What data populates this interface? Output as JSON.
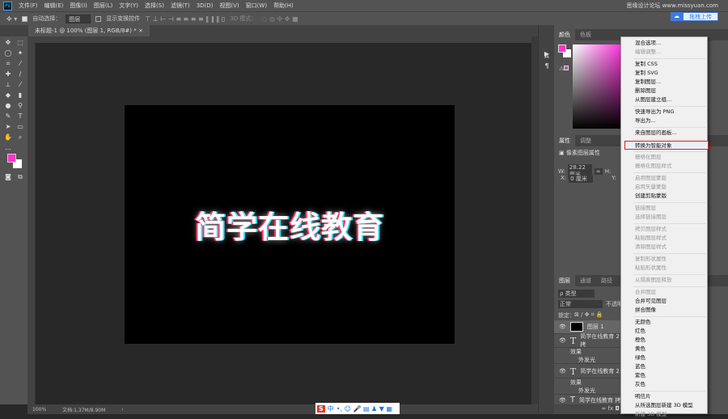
{
  "app": {
    "logo": "Ps",
    "watermark": "思缘设计论坛 www.missyuan.com"
  },
  "menubar": [
    "文件(F)",
    "编辑(E)",
    "图像(I)",
    "图层(L)",
    "文字(Y)",
    "选择(S)",
    "滤镜(T)",
    "3D(D)",
    "视图(V)",
    "窗口(W)",
    "帮助(H)"
  ],
  "options": {
    "auto_select_label": "自动选择：",
    "auto_select_value": "图层",
    "show_transform": "显示变换控件",
    "mode_3d": "3D 模式：",
    "upload": "拖拽上传"
  },
  "doc_tab": {
    "title": "未标题-1 @ 100% (图层 1, RGB/8#) *",
    "close": "×"
  },
  "canvas": {
    "text": "简学在线教育"
  },
  "status": {
    "zoom": "100%",
    "doc": "文档:1.37M/8.90M",
    "arrow": "›"
  },
  "ime": {
    "logo": "S",
    "lang": "中"
  },
  "panels": {
    "color_tabs": [
      "颜色",
      "色板"
    ],
    "props_tabs": [
      "属性",
      "调整"
    ],
    "props_title": "像素图层属性",
    "w_label": "W:",
    "w_value": "28.22 厘米",
    "h_label": "H:",
    "x_label": "X:",
    "x_value": "0 厘米",
    "y_label": "Y:",
    "layer_tabs": [
      "图层",
      "通道",
      "路径"
    ],
    "filter": "ρ 类型",
    "blend": "正常",
    "opacity": "不透明",
    "lock": "锁定：",
    "layers": [
      "图层 1",
      "简学在线教育 2拷",
      "效果",
      "外发光",
      "简学在线教育 2",
      "效果",
      "外发光",
      "简学在线教育 拷"
    ],
    "colors": {
      "foreground": "#ff33cc",
      "background": "#ffffff"
    }
  },
  "context_menu": [
    {
      "label": "混合选项...",
      "d": false
    },
    {
      "label": "编辑调整...",
      "d": true
    },
    {
      "sep": true
    },
    {
      "label": "复制 CSS",
      "d": false
    },
    {
      "label": "复制 SVG",
      "d": false
    },
    {
      "label": "复制图层...",
      "d": false
    },
    {
      "label": "删除图层",
      "d": false
    },
    {
      "label": "从图层建立组...",
      "d": false
    },
    {
      "sep": true
    },
    {
      "label": "快速导出为 PNG",
      "d": false
    },
    {
      "label": "导出为...",
      "d": false
    },
    {
      "sep": true
    },
    {
      "label": "来自图层的画板...",
      "d": false
    },
    {
      "sep": true
    },
    {
      "label": "转换为智能对象",
      "d": false,
      "hl": true
    },
    {
      "sep": true
    },
    {
      "label": "栅格化图层",
      "d": true
    },
    {
      "label": "栅格化图层样式",
      "d": true
    },
    {
      "sep": true
    },
    {
      "label": "启用图层蒙版",
      "d": true
    },
    {
      "label": "启用矢量蒙版",
      "d": true
    },
    {
      "label": "创建剪贴蒙版",
      "d": false
    },
    {
      "sep": true
    },
    {
      "label": "链接图层",
      "d": true
    },
    {
      "label": "选择链接图层",
      "d": true
    },
    {
      "sep": true
    },
    {
      "label": "拷贝图层样式",
      "d": true
    },
    {
      "label": "粘贴图层样式",
      "d": true
    },
    {
      "label": "清除图层样式",
      "d": true
    },
    {
      "sep": true
    },
    {
      "label": "复制形状属性",
      "d": true
    },
    {
      "label": "粘贴形状属性",
      "d": true
    },
    {
      "sep": true
    },
    {
      "label": "从隔离图层释放",
      "d": true
    },
    {
      "sep": true
    },
    {
      "label": "合并图层",
      "d": true
    },
    {
      "label": "合并可见图层",
      "d": false
    },
    {
      "label": "拼合图像",
      "d": false
    },
    {
      "sep": true
    },
    {
      "label": "无颜色",
      "d": false
    },
    {
      "label": "红色",
      "d": false
    },
    {
      "label": "橙色",
      "d": false
    },
    {
      "label": "黄色",
      "d": false
    },
    {
      "label": "绿色",
      "d": false
    },
    {
      "label": "蓝色",
      "d": false
    },
    {
      "label": "紫色",
      "d": false
    },
    {
      "label": "灰色",
      "d": false
    },
    {
      "sep": true
    },
    {
      "label": "明信片",
      "d": false
    },
    {
      "label": "从所选图层新建 3D 模型",
      "d": false
    },
    {
      "label": "新建 3D 模型",
      "d": true
    }
  ]
}
